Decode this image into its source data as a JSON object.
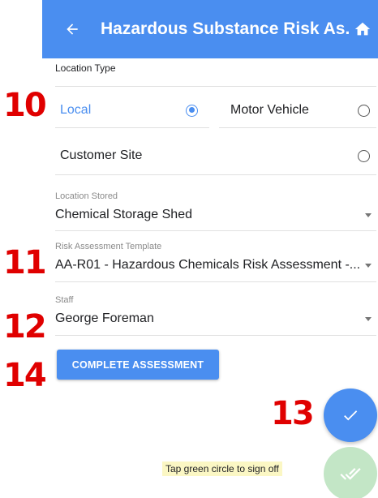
{
  "appbar": {
    "title": "Hazardous Substance Risk As...",
    "back_icon": "arrow-left-icon",
    "home_icon": "home-icon",
    "background": "#4a8ef0"
  },
  "steps": {
    "s10": "10",
    "s11": "11",
    "s12": "12",
    "s13": "13",
    "s14": "14"
  },
  "location_type": {
    "label": "Location Type",
    "options": [
      {
        "label": "Local",
        "selected": true
      },
      {
        "label": "Motor Vehicle",
        "selected": false
      },
      {
        "label": "Customer Site",
        "selected": false
      }
    ]
  },
  "location_stored": {
    "label": "Location Stored",
    "value": "Chemical Storage Shed"
  },
  "risk_template": {
    "label": "Risk Assessment Template",
    "value": "AA-R01 - Hazardous Chemicals Risk Assessment -..."
  },
  "staff": {
    "label": "Staff",
    "value": "George Foreman"
  },
  "complete_button": {
    "label": "COMPLETE ASSESSMENT"
  },
  "hint": {
    "text": "Tap green circle to sign off"
  },
  "colors": {
    "accent": "#4a8ef0",
    "annotation": "#e00000",
    "signoff": "#c3e6c6",
    "hint_bg": "#fbf7c4"
  }
}
